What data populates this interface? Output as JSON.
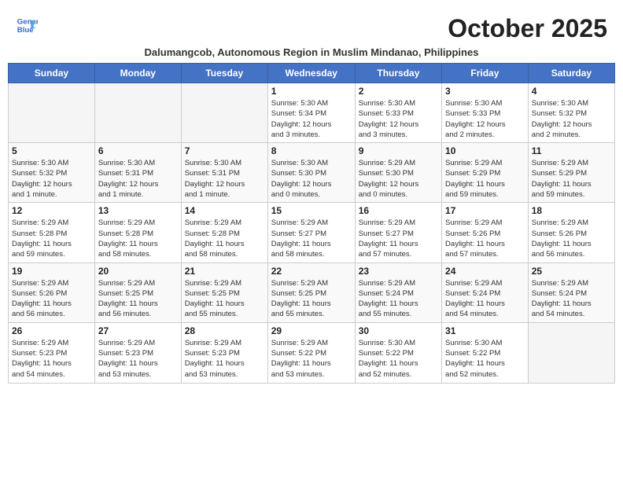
{
  "header": {
    "logo_line1": "General",
    "logo_line2": "Blue",
    "month_title": "October 2025",
    "subtitle": "Dalumangcob, Autonomous Region in Muslim Mindanao, Philippines"
  },
  "days_of_week": [
    "Sunday",
    "Monday",
    "Tuesday",
    "Wednesday",
    "Thursday",
    "Friday",
    "Saturday"
  ],
  "weeks": [
    [
      {
        "day": "",
        "info": ""
      },
      {
        "day": "",
        "info": ""
      },
      {
        "day": "",
        "info": ""
      },
      {
        "day": "1",
        "info": "Sunrise: 5:30 AM\nSunset: 5:34 PM\nDaylight: 12 hours\nand 3 minutes."
      },
      {
        "day": "2",
        "info": "Sunrise: 5:30 AM\nSunset: 5:33 PM\nDaylight: 12 hours\nand 3 minutes."
      },
      {
        "day": "3",
        "info": "Sunrise: 5:30 AM\nSunset: 5:33 PM\nDaylight: 12 hours\nand 2 minutes."
      },
      {
        "day": "4",
        "info": "Sunrise: 5:30 AM\nSunset: 5:32 PM\nDaylight: 12 hours\nand 2 minutes."
      }
    ],
    [
      {
        "day": "5",
        "info": "Sunrise: 5:30 AM\nSunset: 5:32 PM\nDaylight: 12 hours\nand 1 minute."
      },
      {
        "day": "6",
        "info": "Sunrise: 5:30 AM\nSunset: 5:31 PM\nDaylight: 12 hours\nand 1 minute."
      },
      {
        "day": "7",
        "info": "Sunrise: 5:30 AM\nSunset: 5:31 PM\nDaylight: 12 hours\nand 1 minute."
      },
      {
        "day": "8",
        "info": "Sunrise: 5:30 AM\nSunset: 5:30 PM\nDaylight: 12 hours\nand 0 minutes."
      },
      {
        "day": "9",
        "info": "Sunrise: 5:29 AM\nSunset: 5:30 PM\nDaylight: 12 hours\nand 0 minutes."
      },
      {
        "day": "10",
        "info": "Sunrise: 5:29 AM\nSunset: 5:29 PM\nDaylight: 11 hours\nand 59 minutes."
      },
      {
        "day": "11",
        "info": "Sunrise: 5:29 AM\nSunset: 5:29 PM\nDaylight: 11 hours\nand 59 minutes."
      }
    ],
    [
      {
        "day": "12",
        "info": "Sunrise: 5:29 AM\nSunset: 5:28 PM\nDaylight: 11 hours\nand 59 minutes."
      },
      {
        "day": "13",
        "info": "Sunrise: 5:29 AM\nSunset: 5:28 PM\nDaylight: 11 hours\nand 58 minutes."
      },
      {
        "day": "14",
        "info": "Sunrise: 5:29 AM\nSunset: 5:28 PM\nDaylight: 11 hours\nand 58 minutes."
      },
      {
        "day": "15",
        "info": "Sunrise: 5:29 AM\nSunset: 5:27 PM\nDaylight: 11 hours\nand 58 minutes."
      },
      {
        "day": "16",
        "info": "Sunrise: 5:29 AM\nSunset: 5:27 PM\nDaylight: 11 hours\nand 57 minutes."
      },
      {
        "day": "17",
        "info": "Sunrise: 5:29 AM\nSunset: 5:26 PM\nDaylight: 11 hours\nand 57 minutes."
      },
      {
        "day": "18",
        "info": "Sunrise: 5:29 AM\nSunset: 5:26 PM\nDaylight: 11 hours\nand 56 minutes."
      }
    ],
    [
      {
        "day": "19",
        "info": "Sunrise: 5:29 AM\nSunset: 5:26 PM\nDaylight: 11 hours\nand 56 minutes."
      },
      {
        "day": "20",
        "info": "Sunrise: 5:29 AM\nSunset: 5:25 PM\nDaylight: 11 hours\nand 56 minutes."
      },
      {
        "day": "21",
        "info": "Sunrise: 5:29 AM\nSunset: 5:25 PM\nDaylight: 11 hours\nand 55 minutes."
      },
      {
        "day": "22",
        "info": "Sunrise: 5:29 AM\nSunset: 5:25 PM\nDaylight: 11 hours\nand 55 minutes."
      },
      {
        "day": "23",
        "info": "Sunrise: 5:29 AM\nSunset: 5:24 PM\nDaylight: 11 hours\nand 55 minutes."
      },
      {
        "day": "24",
        "info": "Sunrise: 5:29 AM\nSunset: 5:24 PM\nDaylight: 11 hours\nand 54 minutes."
      },
      {
        "day": "25",
        "info": "Sunrise: 5:29 AM\nSunset: 5:24 PM\nDaylight: 11 hours\nand 54 minutes."
      }
    ],
    [
      {
        "day": "26",
        "info": "Sunrise: 5:29 AM\nSunset: 5:23 PM\nDaylight: 11 hours\nand 54 minutes."
      },
      {
        "day": "27",
        "info": "Sunrise: 5:29 AM\nSunset: 5:23 PM\nDaylight: 11 hours\nand 53 minutes."
      },
      {
        "day": "28",
        "info": "Sunrise: 5:29 AM\nSunset: 5:23 PM\nDaylight: 11 hours\nand 53 minutes."
      },
      {
        "day": "29",
        "info": "Sunrise: 5:29 AM\nSunset: 5:22 PM\nDaylight: 11 hours\nand 53 minutes."
      },
      {
        "day": "30",
        "info": "Sunrise: 5:30 AM\nSunset: 5:22 PM\nDaylight: 11 hours\nand 52 minutes."
      },
      {
        "day": "31",
        "info": "Sunrise: 5:30 AM\nSunset: 5:22 PM\nDaylight: 11 hours\nand 52 minutes."
      },
      {
        "day": "",
        "info": ""
      }
    ]
  ]
}
